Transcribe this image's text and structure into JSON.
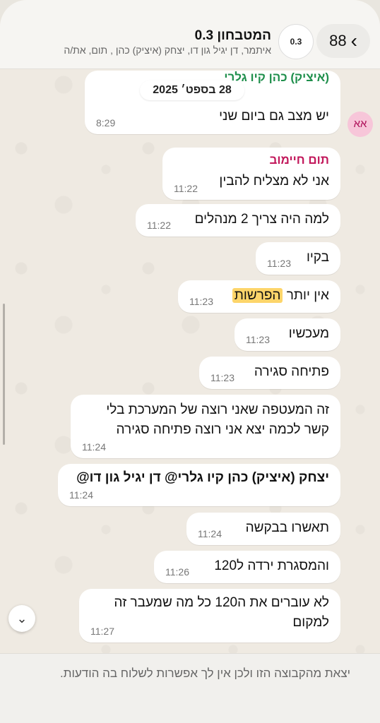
{
  "header": {
    "back_count": "88",
    "avatar_label": "0.3",
    "title": "המטבחון 0.3",
    "subtitle": "איתמר, דן יגיל גון דו, יצחק (איציק) כהן , תום, את/ה"
  },
  "date_chip": "28 בספט׳ 2025",
  "messages": [
    {
      "sender": "(איציק) כהן קיו גלרי",
      "text": "יש מצב גם ביום שני",
      "time": "8:29",
      "sender_avatar": "אא"
    },
    {
      "sender": "תום חיימוב",
      "text": "אני לא מצליח להבין",
      "time": "11:22"
    },
    {
      "text": "למה היה צריך 2 מנהלים",
      "time": "11:22"
    },
    {
      "text": "בקיו",
      "time": "11:23"
    },
    {
      "text_before": "אין יותר ",
      "highlight": "הפרשות",
      "time": "11:23"
    },
    {
      "text": "מעכשיו",
      "time": "11:23"
    },
    {
      "text": "פתיחה סגירה",
      "time": "11:23"
    },
    {
      "text": "זה המעטפה שאני רוצה של המערכת בלי קשר לכמה יצא אני רוצה פתיחה סגירה",
      "time": "11:24"
    },
    {
      "text_sender": "יצחק (איציק) כהן קיו גלרי",
      "text_at": "@",
      "text_mention": "דן יגיל גון דו@",
      "time": "11:24"
    },
    {
      "text": "תאשרו בבקשה",
      "time": "11:24"
    },
    {
      "text": "והמסגרת ירדה ל120",
      "time": "11:26"
    },
    {
      "text": "לא עוברים את ה120 כל מה שמעבר זה למקום",
      "time": "11:27"
    }
  ],
  "footer": {
    "text": "יצאת מהקבוצה הזו ולכן אין לך אפשרות לשלוח בה הודעות."
  }
}
